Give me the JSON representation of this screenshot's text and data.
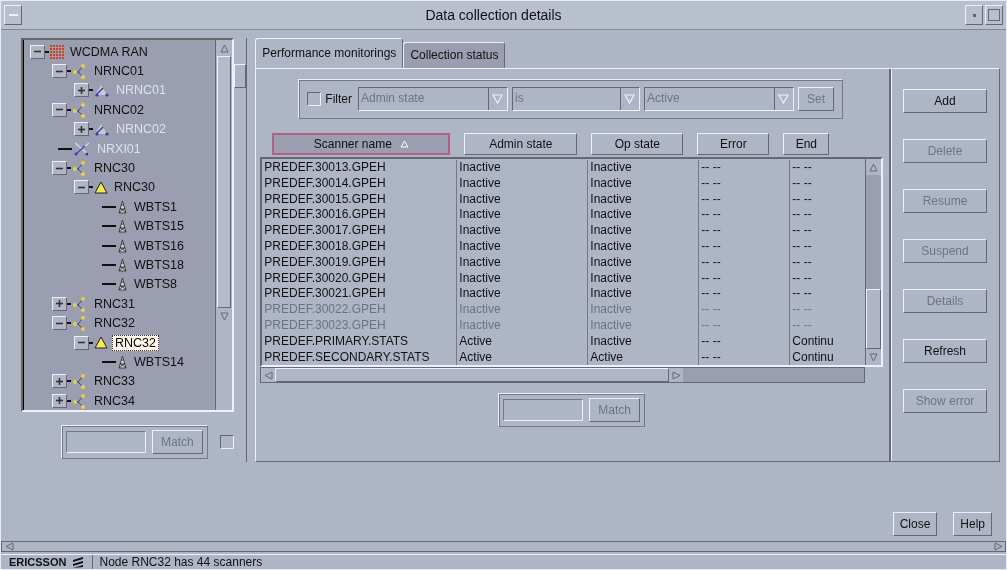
{
  "window": {
    "title": "Data collection details"
  },
  "tree": [
    {
      "label": "WCDMA RAN",
      "kind": "root",
      "expanded": true,
      "disabled": false,
      "selected": false,
      "children": [
        {
          "label": "NRNC01",
          "kind": "rnc",
          "expanded": true,
          "disabled": false,
          "selected": false,
          "children": [
            {
              "label": "NRNC01",
              "kind": "link",
              "expanded": false,
              "disabled": true,
              "selected": false
            }
          ]
        },
        {
          "label": "NRNC02",
          "kind": "rnc",
          "expanded": true,
          "disabled": false,
          "selected": false,
          "children": [
            {
              "label": "NRNC02",
              "kind": "link",
              "expanded": false,
              "disabled": true,
              "selected": false
            }
          ]
        },
        {
          "label": "NRXI01",
          "kind": "cross",
          "disabled": true,
          "selected": false
        },
        {
          "label": "RNC30",
          "kind": "rnc",
          "expanded": true,
          "disabled": false,
          "selected": false,
          "children": [
            {
              "label": "RNC30",
              "kind": "alarm",
              "expanded": true,
              "disabled": false,
              "selected": false,
              "children": [
                {
                  "label": "WBTS1",
                  "kind": "tower",
                  "disabled": false,
                  "selected": false
                },
                {
                  "label": "WBTS15",
                  "kind": "tower",
                  "disabled": false,
                  "selected": false
                },
                {
                  "label": "WBTS16",
                  "kind": "tower",
                  "disabled": false,
                  "selected": false
                },
                {
                  "label": "WBTS18",
                  "kind": "tower",
                  "disabled": false,
                  "selected": false
                },
                {
                  "label": "WBTS8",
                  "kind": "tower",
                  "disabled": false,
                  "selected": false
                }
              ]
            }
          ]
        },
        {
          "label": "RNC31",
          "kind": "rnc",
          "expanded": false,
          "disabled": false,
          "selected": false
        },
        {
          "label": "RNC32",
          "kind": "rnc",
          "expanded": true,
          "disabled": false,
          "selected": false,
          "children": [
            {
              "label": "RNC32",
              "kind": "alarm",
              "expanded": true,
              "disabled": false,
              "selected": true,
              "children": [
                {
                  "label": "WBTS14",
                  "kind": "tower",
                  "disabled": false,
                  "selected": false
                }
              ]
            }
          ]
        },
        {
          "label": "RNC33",
          "kind": "rnc",
          "expanded": false,
          "disabled": false,
          "selected": false
        },
        {
          "label": "RNC34",
          "kind": "rnc",
          "expanded": false,
          "disabled": false,
          "selected": false
        }
      ]
    }
  ],
  "tree_match": {
    "button": "Match",
    "disabled": true,
    "checked": false
  },
  "tabs": [
    {
      "label": "Performance monitorings",
      "selected": true
    },
    {
      "label": "Collection status",
      "selected": false
    }
  ],
  "filter": {
    "label": "Filter",
    "checked": false,
    "dropdowns": [
      {
        "value": "Admin state",
        "disabled": true
      },
      {
        "value": "is",
        "disabled": true
      },
      {
        "value": "Active",
        "disabled": true
      }
    ],
    "set_button": {
      "label": "Set",
      "disabled": true
    }
  },
  "table": {
    "columns": [
      {
        "label": "Scanner name",
        "sorted": true
      },
      {
        "label": "Admin state",
        "sorted": false
      },
      {
        "label": "Op state",
        "sorted": false
      },
      {
        "label": "Error",
        "sorted": false
      },
      {
        "label": "End",
        "sorted": false
      }
    ],
    "rows": [
      {
        "cells": [
          "PREDEF.30013.GPEH",
          "Inactive",
          "Inactive",
          "-- --",
          "-- --"
        ],
        "disabled": false
      },
      {
        "cells": [
          "PREDEF.30014.GPEH",
          "Inactive",
          "Inactive",
          "-- --",
          "-- --"
        ],
        "disabled": false
      },
      {
        "cells": [
          "PREDEF.30015.GPEH",
          "Inactive",
          "Inactive",
          "-- --",
          "-- --"
        ],
        "disabled": false
      },
      {
        "cells": [
          "PREDEF.30016.GPEH",
          "Inactive",
          "Inactive",
          "-- --",
          "-- --"
        ],
        "disabled": false
      },
      {
        "cells": [
          "PREDEF.30017.GPEH",
          "Inactive",
          "Inactive",
          "-- --",
          "-- --"
        ],
        "disabled": false
      },
      {
        "cells": [
          "PREDEF.30018.GPEH",
          "Inactive",
          "Inactive",
          "-- --",
          "-- --"
        ],
        "disabled": false
      },
      {
        "cells": [
          "PREDEF.30019.GPEH",
          "Inactive",
          "Inactive",
          "-- --",
          "-- --"
        ],
        "disabled": false
      },
      {
        "cells": [
          "PREDEF.30020.GPEH",
          "Inactive",
          "Inactive",
          "-- --",
          "-- --"
        ],
        "disabled": false
      },
      {
        "cells": [
          "PREDEF.30021.GPEH",
          "Inactive",
          "Inactive",
          "-- --",
          "-- --"
        ],
        "disabled": false
      },
      {
        "cells": [
          "PREDEF.30022.GPEH",
          "Inactive",
          "Inactive",
          "-- --",
          "-- --"
        ],
        "disabled": true
      },
      {
        "cells": [
          "PREDEF.30023.GPEH",
          "Inactive",
          "Inactive",
          "-- --",
          "-- --"
        ],
        "disabled": true
      },
      {
        "cells": [
          "PREDEF.PRIMARY.STATS",
          "Active",
          "Inactive",
          "-- --",
          "Continu"
        ],
        "disabled": false
      },
      {
        "cells": [
          "PREDEF.SECONDARY.STATS",
          "Active",
          "Active",
          "-- --",
          "Continu"
        ],
        "disabled": false
      }
    ]
  },
  "table_match": {
    "button": "Match",
    "disabled": true
  },
  "side_buttons": [
    {
      "label": "Add",
      "disabled": false
    },
    {
      "label": "Delete",
      "disabled": true
    },
    {
      "label": "Resume",
      "disabled": true
    },
    {
      "label": "Suspend",
      "disabled": true
    },
    {
      "label": "Details",
      "disabled": true
    },
    {
      "label": "Refresh",
      "disabled": false
    },
    {
      "label": "Show error",
      "disabled": true
    }
  ],
  "dialog_buttons": [
    {
      "label": "Close",
      "disabled": false
    },
    {
      "label": "Help",
      "disabled": false
    }
  ],
  "status_bar": {
    "brand": "ERICSSON",
    "message": "Node RNC32 has 44 scanners"
  }
}
